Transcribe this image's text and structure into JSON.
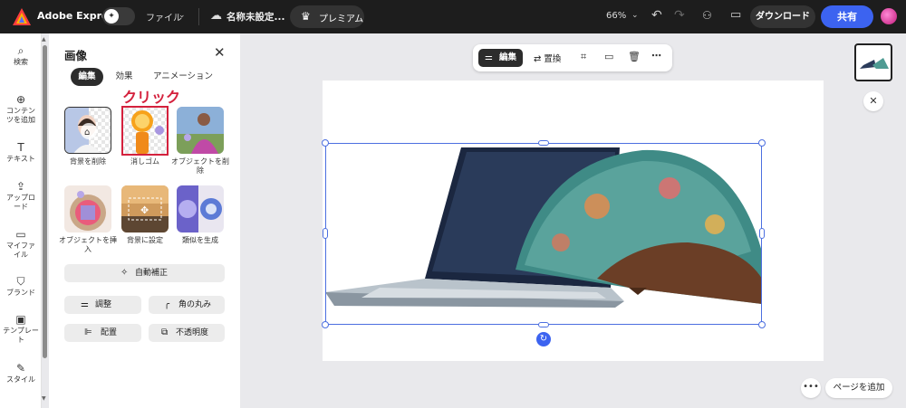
{
  "topbar": {
    "app_name": "Adobe Express",
    "file_menu": "ファイル",
    "doc_name": "名称未設定...",
    "premium": "プレミアム",
    "zoom": "66%",
    "download": "ダウンロード",
    "share": "共有"
  },
  "leftrail": {
    "items": [
      {
        "label": "検索",
        "icon": "search-icon"
      },
      {
        "label": "コンテンツを追加",
        "icon": "plus-circle-icon"
      },
      {
        "label": "テキスト",
        "icon": "text-icon"
      },
      {
        "label": "アップロード",
        "icon": "upload-icon"
      },
      {
        "label": "マイファイル",
        "icon": "folder-icon"
      },
      {
        "label": "ブランド",
        "icon": "brand-icon"
      },
      {
        "label": "テンプレート",
        "icon": "template-icon"
      },
      {
        "label": "スタイル",
        "icon": "style-icon"
      }
    ]
  },
  "panel": {
    "title": "画像",
    "tabs": [
      "編集",
      "効果",
      "アニメーション"
    ],
    "annotation": "クリック",
    "tools": [
      {
        "label": "背景を削除"
      },
      {
        "label": "消しゴム"
      },
      {
        "label": "オブジェクトを削除"
      },
      {
        "label": "オブジェクトを挿入"
      },
      {
        "label": "背景に設定"
      },
      {
        "label": "類似を生成"
      }
    ],
    "auto_enhance": "自動補正",
    "adjust": "調整",
    "corner_radius": "角の丸み",
    "arrange": "配置",
    "opacity": "不透明度"
  },
  "canvas_toolbar": {
    "edit": "編集",
    "replace": "置換"
  },
  "canvas": {
    "add_page": "ページを追加"
  },
  "colors": {
    "accent": "#3c63f0",
    "annotation_red": "#d4213d",
    "topbar_bg": "#1d1d1d"
  }
}
